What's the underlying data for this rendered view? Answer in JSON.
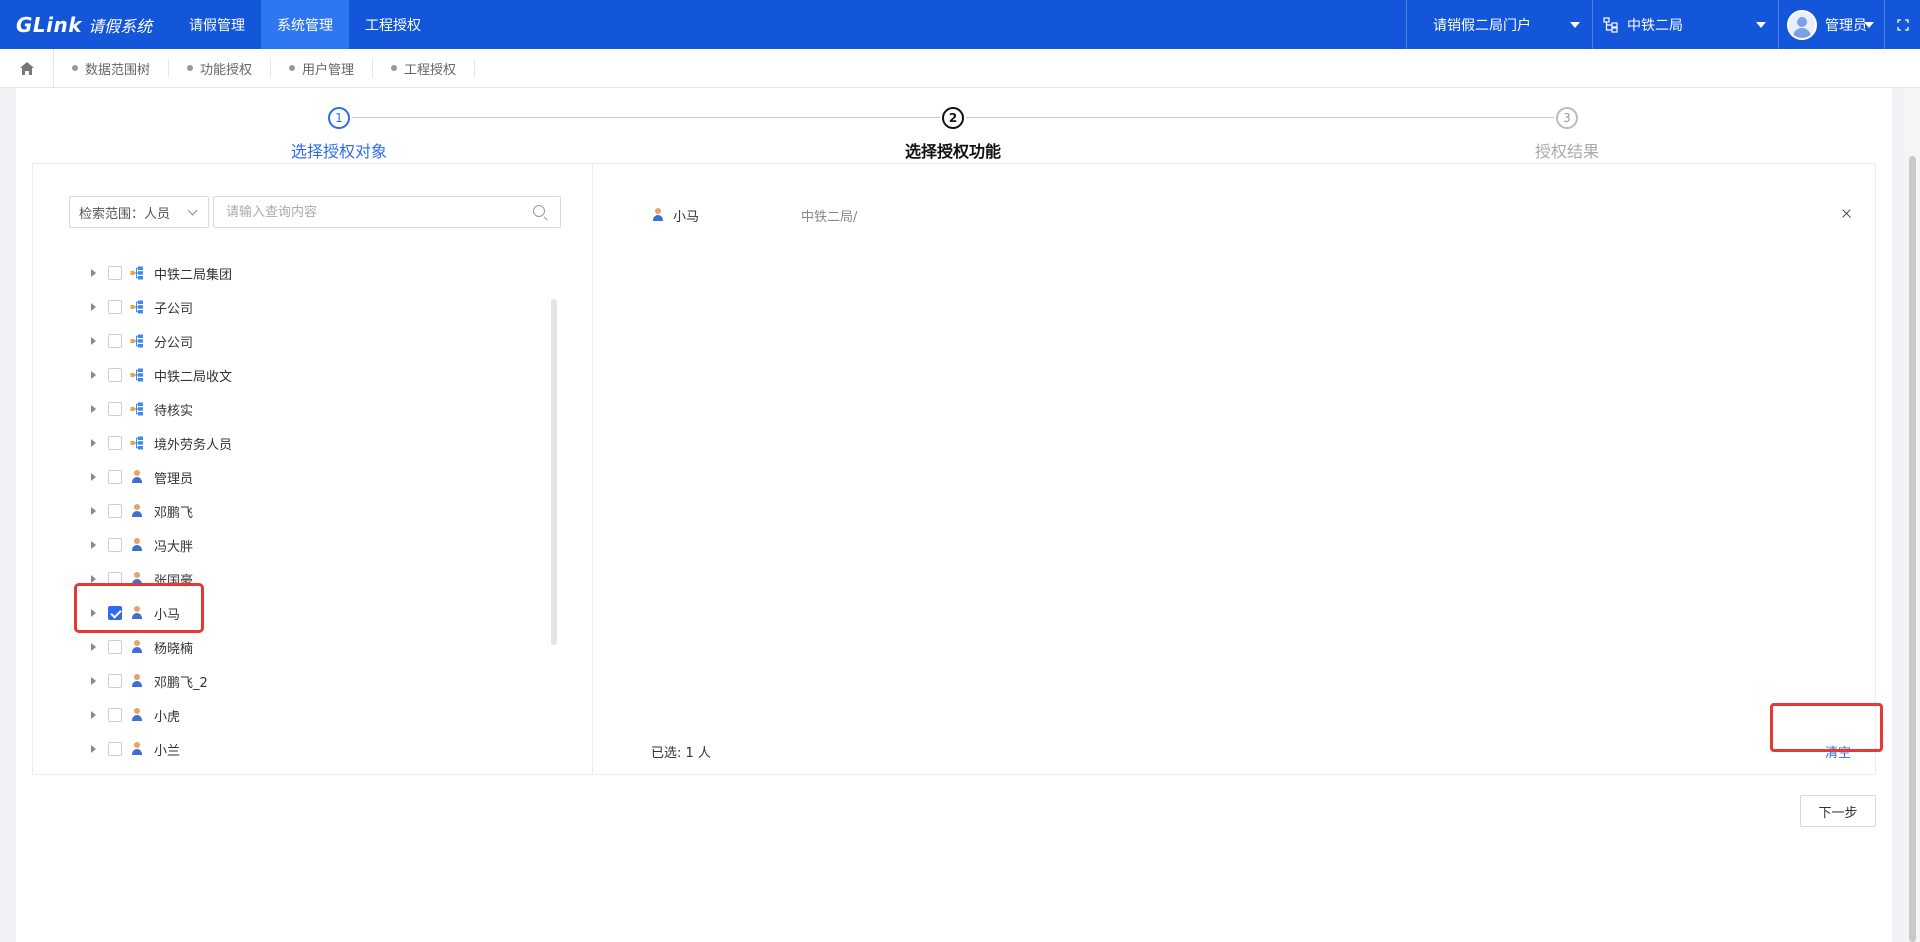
{
  "header": {
    "logo_mark": "GLink",
    "logo_system": "请假系统",
    "nav": [
      {
        "label": "请假管理"
      },
      {
        "label": "系统管理"
      },
      {
        "label": "工程授权"
      }
    ],
    "portal_label": "请销假二局门户",
    "org_label": "中铁二局",
    "user_label": "管理员",
    "accent_color": "#1356d9"
  },
  "tabs": [
    {
      "label": "数据范围树"
    },
    {
      "label": "功能授权"
    },
    {
      "label": "用户管理"
    },
    {
      "label": "工程授权"
    }
  ],
  "steps": [
    {
      "number": "1",
      "label": "选择授权对象",
      "state": "done"
    },
    {
      "number": "2",
      "label": "选择授权功能",
      "state": "current"
    },
    {
      "number": "3",
      "label": "授权结果",
      "state": "pending"
    }
  ],
  "search": {
    "scope_label": "检索范围：人员",
    "placeholder": "请输入查询内容",
    "value": ""
  },
  "tree": [
    {
      "label": "中铁二局集团",
      "type": "org",
      "checked": false
    },
    {
      "label": "子公司",
      "type": "org",
      "checked": false
    },
    {
      "label": "分公司",
      "type": "org",
      "checked": false
    },
    {
      "label": "中铁二局收文",
      "type": "org",
      "checked": false
    },
    {
      "label": "待核实",
      "type": "org",
      "checked": false
    },
    {
      "label": "境外劳务人员",
      "type": "org",
      "checked": false
    },
    {
      "label": "管理员",
      "type": "person",
      "checked": false
    },
    {
      "label": "邓鹏飞",
      "type": "person",
      "checked": false
    },
    {
      "label": "冯大胖",
      "type": "person",
      "checked": false
    },
    {
      "label": "张国豪",
      "type": "person",
      "checked": false
    },
    {
      "label": "小马",
      "type": "person",
      "checked": true
    },
    {
      "label": "杨晓楠",
      "type": "person",
      "checked": false
    },
    {
      "label": "邓鹏飞_2",
      "type": "person",
      "checked": false
    },
    {
      "label": "小虎",
      "type": "person",
      "checked": false
    },
    {
      "label": "小兰",
      "type": "person",
      "checked": false
    }
  ],
  "selected": {
    "items": [
      {
        "name": "小马",
        "path": "中铁二局/"
      }
    ],
    "count_label": "已选: 1 人",
    "clear_label": "清空"
  },
  "actions": {
    "next_label": "下一步"
  }
}
